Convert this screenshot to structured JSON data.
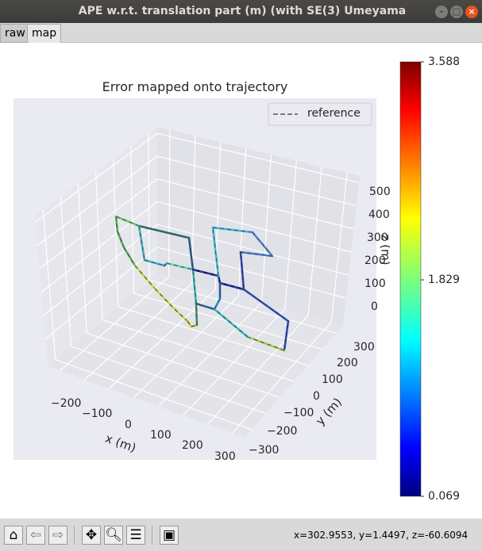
{
  "window": {
    "title": "APE w.r.t. translation part (m) (with SE(3) Umeyama alignment)",
    "buttons": [
      "minimize",
      "maximize",
      "close"
    ]
  },
  "tabs": [
    {
      "label": "raw",
      "active": false
    },
    {
      "label": "map",
      "active": true
    }
  ],
  "chart_data": {
    "type": "line3d",
    "title": "Error mapped onto trajectory",
    "xlabel": "x (m)",
    "ylabel": "y (m)",
    "zlabel": "z (m)",
    "x_ticks": [
      "−200",
      "−100",
      "0",
      "100",
      "200",
      "300"
    ],
    "y_ticks": [
      "300",
      "200",
      "100",
      "0",
      "−100",
      "−200",
      "−300"
    ],
    "z_ticks": [
      "500",
      "400",
      "300",
      "200",
      "100",
      "0"
    ],
    "legend": {
      "entries": [
        {
          "label": "reference",
          "style": "dashed",
          "color": "#555555"
        }
      ],
      "placement": "top-right"
    },
    "colorbar": {
      "colormap": "jet",
      "min": 0.069,
      "max": 3.588,
      "tick_labels": [
        "3.588",
        "1.829",
        "0.069"
      ]
    },
    "grid": true,
    "background": "#eaeaf2"
  },
  "toolbar": {
    "icons": [
      "home-icon",
      "back-icon",
      "forward-icon",
      "pan-icon",
      "zoom-icon",
      "configure-icon",
      "save-icon"
    ],
    "coords": "x=302.9553, y=1.4497, z=-60.6094"
  }
}
